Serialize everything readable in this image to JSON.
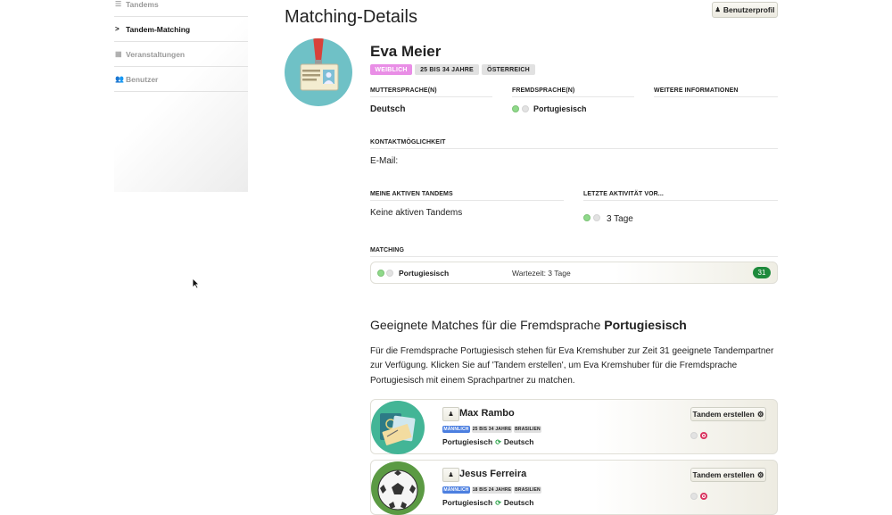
{
  "sidebar": {
    "items": [
      {
        "label": "Tandems",
        "icon": "list-icon"
      },
      {
        "label": "Tandem-Matching",
        "icon": "chevron-right-icon",
        "active": true
      },
      {
        "label": "Veranstaltungen",
        "icon": "calendar-icon"
      },
      {
        "label": "Benutzer",
        "icon": "users-icon"
      }
    ]
  },
  "header": {
    "title": "Matching-Details",
    "profile_button": "Benutzerprofil"
  },
  "profile": {
    "name": "Eva Meier",
    "badges": [
      "WEIBLICH",
      "25 BIS 34 JAHRE",
      "ÖSTERREICH"
    ],
    "native_label": "MUTTERSPRACHE(N)",
    "native_value": "Deutsch",
    "foreign_label": "FREMDSPRACHE(N)",
    "foreign_value": "Portugiesisch",
    "info_label": "WEITERE INFORMATIONEN",
    "contact_label": "KONTAKTMÖGLICHKEIT",
    "contact_value": "E-Mail:",
    "tandems_label": "MEINE AKTIVEN TANDEMS",
    "tandems_value": "Keine aktiven Tandems",
    "activity_label": "LETZTE AKTIVITÄT VOR...",
    "activity_value": "3 Tage",
    "matching_label": "MATCHING",
    "matching_language": "Portugiesisch",
    "matching_wait": "Wartezeit: 3 Tage",
    "matching_count": "31"
  },
  "matches": {
    "title_prefix": "Geeignete Matches für die Fremdsprache",
    "title_language": "Portugiesisch",
    "description": "Für die Fremdsprache Portugiesisch stehen für Eva Kremshuber zur Zeit 31 geeignete Tandempartner zur Verfügung. Klicken Sie auf 'Tandem erstellen', um Eva Kremshuber für die Fremdsprache Portugiesisch mit einem Sprachpartner zu matchen.",
    "create_label": "Tandem erstellen",
    "cards": [
      {
        "name": "Max Rambo",
        "badges": [
          "MÄNNLICH",
          "25 BIS 34 JAHRE",
          "BRASILIEN"
        ],
        "lang_from": "Portugiesisch",
        "lang_to": "Deutsch",
        "avatar": "passport-icon",
        "avatar_color": "#43b596"
      },
      {
        "name": "Jesus Ferreira",
        "badges": [
          "MÄNNLICH",
          "18 BIS 24 JAHRE",
          "BRASILIEN"
        ],
        "lang_from": "Portugiesisch",
        "lang_to": "Deutsch",
        "avatar": "soccer-ball-icon",
        "avatar_color": "#5b9a43"
      }
    ]
  },
  "colors": {
    "female": "#e98ee6",
    "male": "#4c7fe0",
    "count": "#1e8a3c",
    "online": "#8fd98a",
    "target": "#d9335f"
  }
}
